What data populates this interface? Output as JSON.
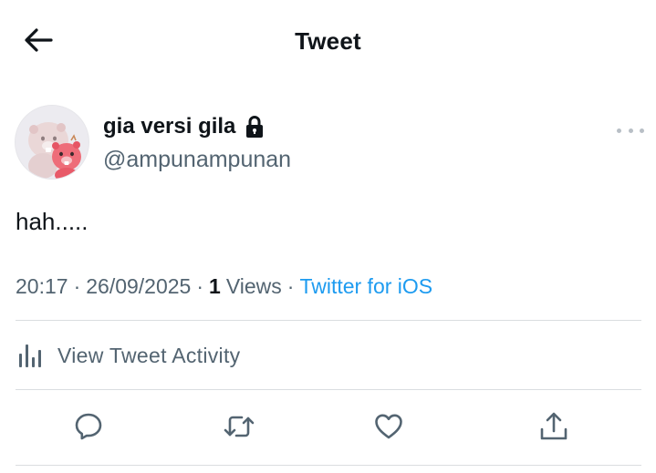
{
  "header": {
    "title": "Tweet",
    "back_icon": "arrow-left-icon"
  },
  "author": {
    "display_name": "gia versi gila",
    "handle": "@ampunampunan",
    "protected_icon": "lock-icon",
    "avatar_icon": "beaver-avatar-image",
    "more_icon": "more-dots-icon"
  },
  "tweet": {
    "text": "hah....."
  },
  "meta": {
    "time": "20:17",
    "separator": "·",
    "date": "26/09/2025",
    "views_count": "1",
    "views_label": "Views",
    "source": "Twitter for iOS"
  },
  "activity": {
    "label": "View Tweet Activity",
    "icon": "analytics-bars-icon"
  },
  "actions": {
    "reply_icon": "reply-bubble-icon",
    "retweet_icon": "retweet-icon",
    "like_icon": "heart-icon",
    "share_icon": "share-upload-icon"
  },
  "colors": {
    "text_primary": "#0f1419",
    "text_secondary": "#536471",
    "link": "#1d9bf0",
    "divider": "#dadde0"
  }
}
